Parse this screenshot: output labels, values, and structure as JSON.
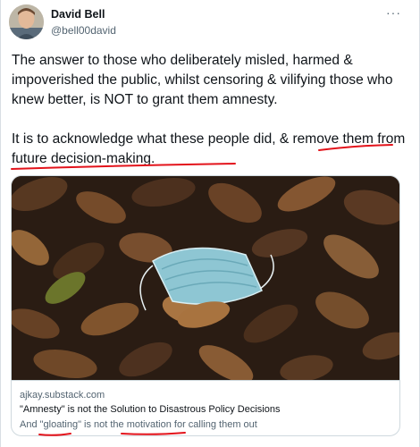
{
  "author": {
    "name": "David Bell",
    "handle": "@bell00david"
  },
  "more_icon": "more-horizontal-icon",
  "tweet": {
    "paragraph_1": "The answer to those who deliberately misled, harmed & impoverished the public, whilst censoring & vilifying those who knew better, is NOT to grant them amnesty.",
    "paragraph_2_plain": "It is to acknowledge what these people did, ",
    "paragraph_2_underlined": "& remove them from future decision-making."
  },
  "link_card": {
    "domain": "ajkay.substack.com",
    "title": "\"Amnesty\" is not the Solution to Disastrous Policy Decisions",
    "description": "And \"gloating\" is not the motivation for calling them out"
  },
  "colors": {
    "text": "#0f1419",
    "secondary": "#536471",
    "border": "#cfd9de",
    "annotation_red": "#e3131b"
  }
}
